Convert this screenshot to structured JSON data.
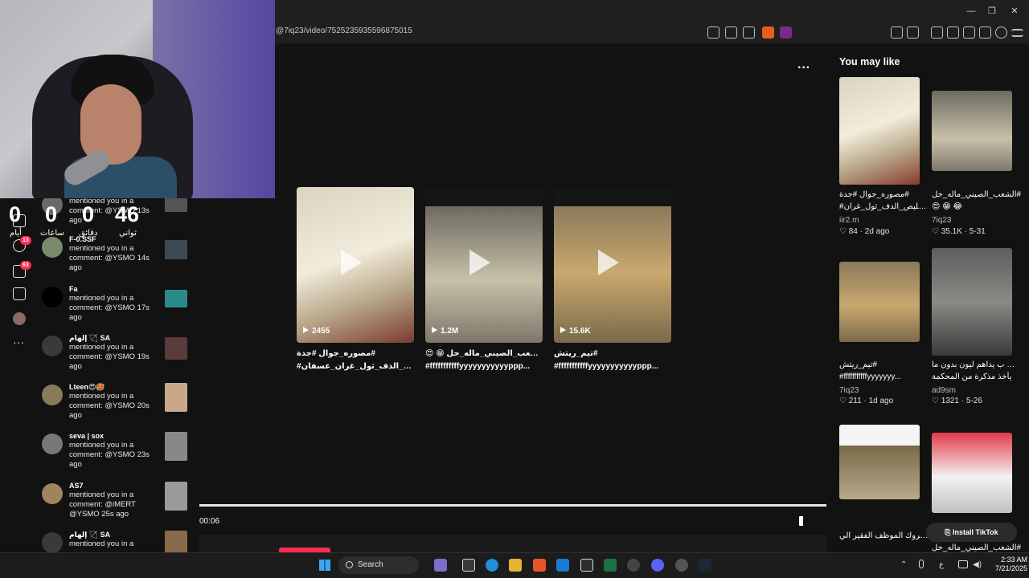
{
  "browser": {
    "url": "@7iq23/video/7525235935596875015",
    "window_controls": [
      "minimize-icon",
      "restore-icon",
      "close-icon"
    ]
  },
  "countdown": {
    "days": {
      "value": "0",
      "label": "أيام"
    },
    "hours": {
      "value": "0",
      "label": "ساعات"
    },
    "minutes": {
      "value": "0",
      "label": "دقائق"
    },
    "seconds": {
      "value": "46",
      "label": "ثواني"
    }
  },
  "rail": {
    "badges": [
      "13",
      "63"
    ]
  },
  "notifications": [
    {
      "name": "",
      "text": "mentioned you in a comment: @YSMO 13s ago"
    },
    {
      "name": "F-0.SSF",
      "text": "mentioned you in a comment: @YSMO 14s ago"
    },
    {
      "name": "Fa",
      "text": "mentioned you in a comment: @YSMO 17s ago"
    },
    {
      "name": "إلهام 🏹 SA",
      "text": "mentioned you in a comment: @YSMO 19s ago"
    },
    {
      "name": "Lteen😍🥵",
      "text": "mentioned you in a comment: @YSMO 20s ago"
    },
    {
      "name": "seva | sox",
      "text": "mentioned you in a comment: @YSMO 23s ago"
    },
    {
      "name": "AS7",
      "text": "mentioned you in a comment: @iMERT @YSMO 25s ago"
    },
    {
      "name": "إلهام 🏹 SA",
      "text": "mentioned you in a"
    }
  ],
  "main": {
    "more_label": "···",
    "videos": [
      {
        "count": "2455",
        "caption1": "مصوره_جوال #جدة#",
        "caption2": "#خليص_الدف_ثول_غران_عسفان"
      },
      {
        "count": "1.2M",
        "caption1": "😍 😁 الشعب_الصيني_ماله_حل#",
        "caption2": "#fffffffffffyyyyyyyyyyyppp..."
      },
      {
        "count": "15.6K",
        "caption1": "تيم_ريتش#",
        "caption2": "#fffffffffffyyyyyyyyyyyppp..."
      }
    ],
    "time": "00:06"
  },
  "right": {
    "title": "You may like",
    "cards": [
      {
        "title1": "مصوره_جوال #جدة#",
        "title2": "#خليص_الدف_ثول_غران_...",
        "author": "iir2.m",
        "likes": "84",
        "date": "2d ago"
      },
      {
        "title1": "الشعب_الصيني_ماله_حل#",
        "title2": "😍 😁 😂",
        "author": "7iq23",
        "likes": "35.1K",
        "date": "5-31"
      },
      {
        "title1": "تيم_ريتش#",
        "title2": "#fffffffffffyyyyyyy...",
        "author": "7iq23",
        "likes": "211",
        "date": "1d ago"
      },
      {
        "title1": "ادولف ب  يداهم ليون بدون ما",
        "title2": "يأخذ مذكرة من المحكمة",
        "author": "ad9sm",
        "likes": "1321",
        "date": "5-26"
      },
      {
        "title1": "قصة مبروك الموظف الفقير الي",
        "title2": "",
        "author": "",
        "likes": "",
        "date": ""
      },
      {
        "title1": "الشعب_الصيني_ماله_حل#",
        "title2": "",
        "author": "",
        "likes": "",
        "date": ""
      }
    ],
    "install": "Install TikTok"
  },
  "taskbar": {
    "search": "Search",
    "time": "2:33 AM",
    "date": "7/21/2025",
    "lang": "ع"
  },
  "colors": {
    "accent": "#fe2c55",
    "bg": "#121212"
  }
}
